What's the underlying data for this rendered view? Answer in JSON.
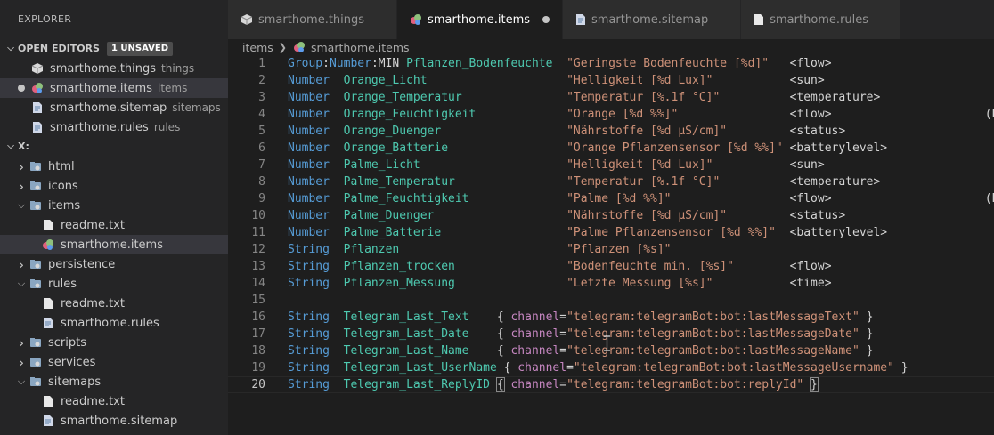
{
  "explorer": {
    "title": "EXPLORER",
    "open_editors": {
      "header": "OPEN EDITORS",
      "badge": "1 UNSAVED",
      "items": [
        {
          "label": "smarthome.things",
          "desc": "things",
          "icon": "package-icon"
        },
        {
          "label": "smarthome.items",
          "desc": "items",
          "icon": "items-icon",
          "modified": true
        },
        {
          "label": "smarthome.sitemap",
          "desc": "sitemaps",
          "icon": "file-icon"
        },
        {
          "label": "smarthome.rules",
          "desc": "rules",
          "icon": "file-icon"
        }
      ]
    },
    "folder": {
      "header": "X:",
      "tree": [
        {
          "label": "html",
          "type": "folder",
          "expanded": false
        },
        {
          "label": "icons",
          "type": "folder",
          "expanded": false
        },
        {
          "label": "items",
          "type": "folder",
          "expanded": true
        },
        {
          "label": "readme.txt",
          "type": "file"
        },
        {
          "label": "smarthome.items",
          "type": "file"
        },
        {
          "label": "persistence",
          "type": "folder",
          "expanded": false
        },
        {
          "label": "rules",
          "type": "folder",
          "expanded": true
        },
        {
          "label": "readme.txt",
          "type": "file"
        },
        {
          "label": "smarthome.rules",
          "type": "file"
        },
        {
          "label": "scripts",
          "type": "folder",
          "expanded": false
        },
        {
          "label": "services",
          "type": "folder",
          "expanded": false
        },
        {
          "label": "sitemaps",
          "type": "folder",
          "expanded": true
        },
        {
          "label": "readme.txt",
          "type": "file"
        },
        {
          "label": "smarthome.sitemap",
          "type": "file"
        }
      ]
    }
  },
  "tabs": [
    {
      "label": "smarthome.things"
    },
    {
      "label": "smarthome.items",
      "active": true,
      "dirty": true
    },
    {
      "label": "smarthome.sitemap"
    },
    {
      "label": "smarthome.rules"
    }
  ],
  "breadcrumb": {
    "folder": "items",
    "file": "smarthome.items"
  },
  "editor": {
    "lines": [
      {
        "n": "1",
        "t": "Group",
        "sep": ":",
        "t2": "Number",
        "sep2": ":",
        "t3": "MIN",
        "name": "Pflanzen_Bodenfeuchte",
        "label": "\"Geringste Bodenfeuchte [%d]\"",
        "tag": "<flow>"
      },
      {
        "n": "2",
        "t": "Number",
        "name": "Orange_Licht",
        "label": "\"Helligkeit [%d Lux]\"",
        "tag": "<sun>"
      },
      {
        "n": "3",
        "t": "Number",
        "name": "Orange_Temperatur",
        "label": "\"Temperatur [%.1f °C]\"",
        "tag": "<temperature>"
      },
      {
        "n": "4",
        "t": "Number",
        "name": "Orange_Feuchtigkeit",
        "label": "\"Orange [%d %%]\"",
        "tag": "<flow>",
        "extra": "(Pf"
      },
      {
        "n": "5",
        "t": "Number",
        "name": "Orange_Duenger",
        "label": "\"Nährstoffe [%d µS/cm]\"",
        "tag": "<status>"
      },
      {
        "n": "6",
        "t": "Number",
        "name": "Orange_Batterie",
        "label": "\"Orange Pflanzensensor [%d %%]\"",
        "tag": "<batterylevel>"
      },
      {
        "n": "7",
        "t": "Number",
        "name": "Palme_Licht",
        "label": "\"Helligkeit [%d Lux]\"",
        "tag": "<sun>"
      },
      {
        "n": "8",
        "t": "Number",
        "name": "Palme_Temperatur",
        "label": "\"Temperatur [%.1f °C]\"",
        "tag": "<temperature>"
      },
      {
        "n": "9",
        "t": "Number",
        "name": "Palme_Feuchtigkeit",
        "label": "\"Palme [%d %%]\"",
        "tag": "<flow>",
        "extra": "(Pf"
      },
      {
        "n": "10",
        "t": "Number",
        "name": "Palme_Duenger",
        "label": "\"Nährstoffe [%d µS/cm]\"",
        "tag": "<status>"
      },
      {
        "n": "11",
        "t": "Number",
        "name": "Palme_Batterie",
        "label": "\"Palme Pflanzensensor [%d %%]\"",
        "tag": "<batterylevel>"
      },
      {
        "n": "12",
        "t": "String",
        "name": "Pflanzen",
        "label": "\"Pflanzen [%s]\""
      },
      {
        "n": "13",
        "t": "String",
        "name": "Pflanzen_trocken",
        "label": "\"Bodenfeuchte min. [%s]\"",
        "tag": "<flow>"
      },
      {
        "n": "14",
        "t": "String",
        "name": "Pflanzen_Messung",
        "label": "\"Letzte Messung [%s]\"",
        "tag": "<time>"
      },
      {
        "n": "15"
      },
      {
        "n": "16",
        "t": "String",
        "name": "Telegram_Last_Text",
        "chan": "\"telegram:telegramBot:bot:lastMessageText\""
      },
      {
        "n": "17",
        "t": "String",
        "name": "Telegram_Last_Date",
        "chan": "\"telegram:telegramBot:bot:lastMessageDate\""
      },
      {
        "n": "18",
        "t": "String",
        "name": "Telegram_Last_Name",
        "chan": "\"telegram:telegramBot:bot:lastMessageName\""
      },
      {
        "n": "19",
        "t": "String",
        "name": "Telegram_Last_UserName",
        "chan": "\"telegram:telegramBot:bot:lastMessageUsername\""
      },
      {
        "n": "20",
        "t": "String",
        "name": "Telegram_Last_ReplyID",
        "chan": "\"telegram:telegramBot:bot:replyId\"",
        "current": true
      }
    ],
    "channel_kw": "channel",
    "open_brace": "{",
    "close_brace": "}"
  },
  "colors": {
    "keyword": "#569cd6",
    "identifier": "#4ec9b0",
    "string": "#ce9178",
    "attr": "#c586c0"
  }
}
